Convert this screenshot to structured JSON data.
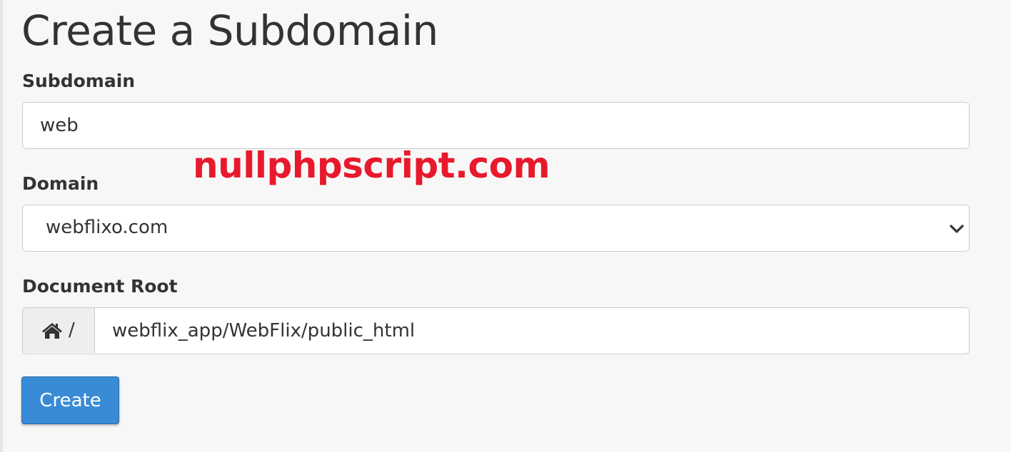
{
  "page": {
    "title": "Create a Subdomain"
  },
  "form": {
    "subdomain": {
      "label": "Subdomain",
      "value": "web"
    },
    "domain": {
      "label": "Domain",
      "selected": "webflixo.com"
    },
    "document_root": {
      "label": "Document Root",
      "prefix_icon": "home-icon",
      "prefix_text": "/",
      "value": "webflix_app/WebFlix/public_html"
    },
    "submit_label": "Create"
  },
  "watermark": {
    "text": "nullphpscript.com",
    "color": "#e8192c"
  },
  "colors": {
    "button": "#3a8bd6",
    "background": "#f7f7f7"
  }
}
